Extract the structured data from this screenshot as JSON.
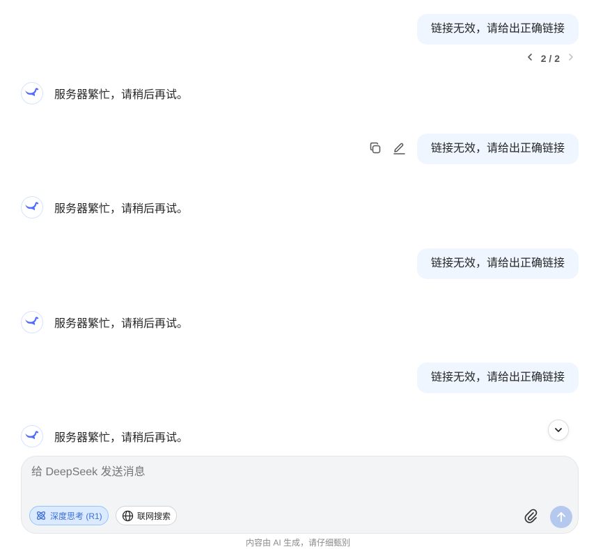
{
  "conversation": {
    "user_messages": [
      "链接无效，请给出正确链接",
      "链接无效，请给出正确链接",
      "链接无效，请给出正确链接",
      "链接无效，请给出正确链接"
    ],
    "assistant_messages": [
      "服务器繁忙，请稍后再试。",
      "服务器繁忙，请稍后再试。",
      "服务器繁忙，请稍后再试。",
      "服务器繁忙，请稍后再试。"
    ],
    "pager": {
      "current": "2",
      "separator": "/",
      "total": "2"
    }
  },
  "message_actions": {
    "icons": [
      "copy-icon",
      "edit-icon"
    ]
  },
  "composer": {
    "placeholder": "给 DeepSeek 发送消息",
    "deep_think_label": "深度思考 (R1)",
    "web_search_label": "联网搜索"
  },
  "footer": {
    "note": "内容由 AI 生成，请仔细甄别"
  },
  "colors": {
    "user_bubble_bg": "#eff6ff",
    "accent_blue": "#4d6bfe",
    "deep_think_bg": "#dbeafe",
    "send_button_disabled": "#b5c8ee"
  }
}
